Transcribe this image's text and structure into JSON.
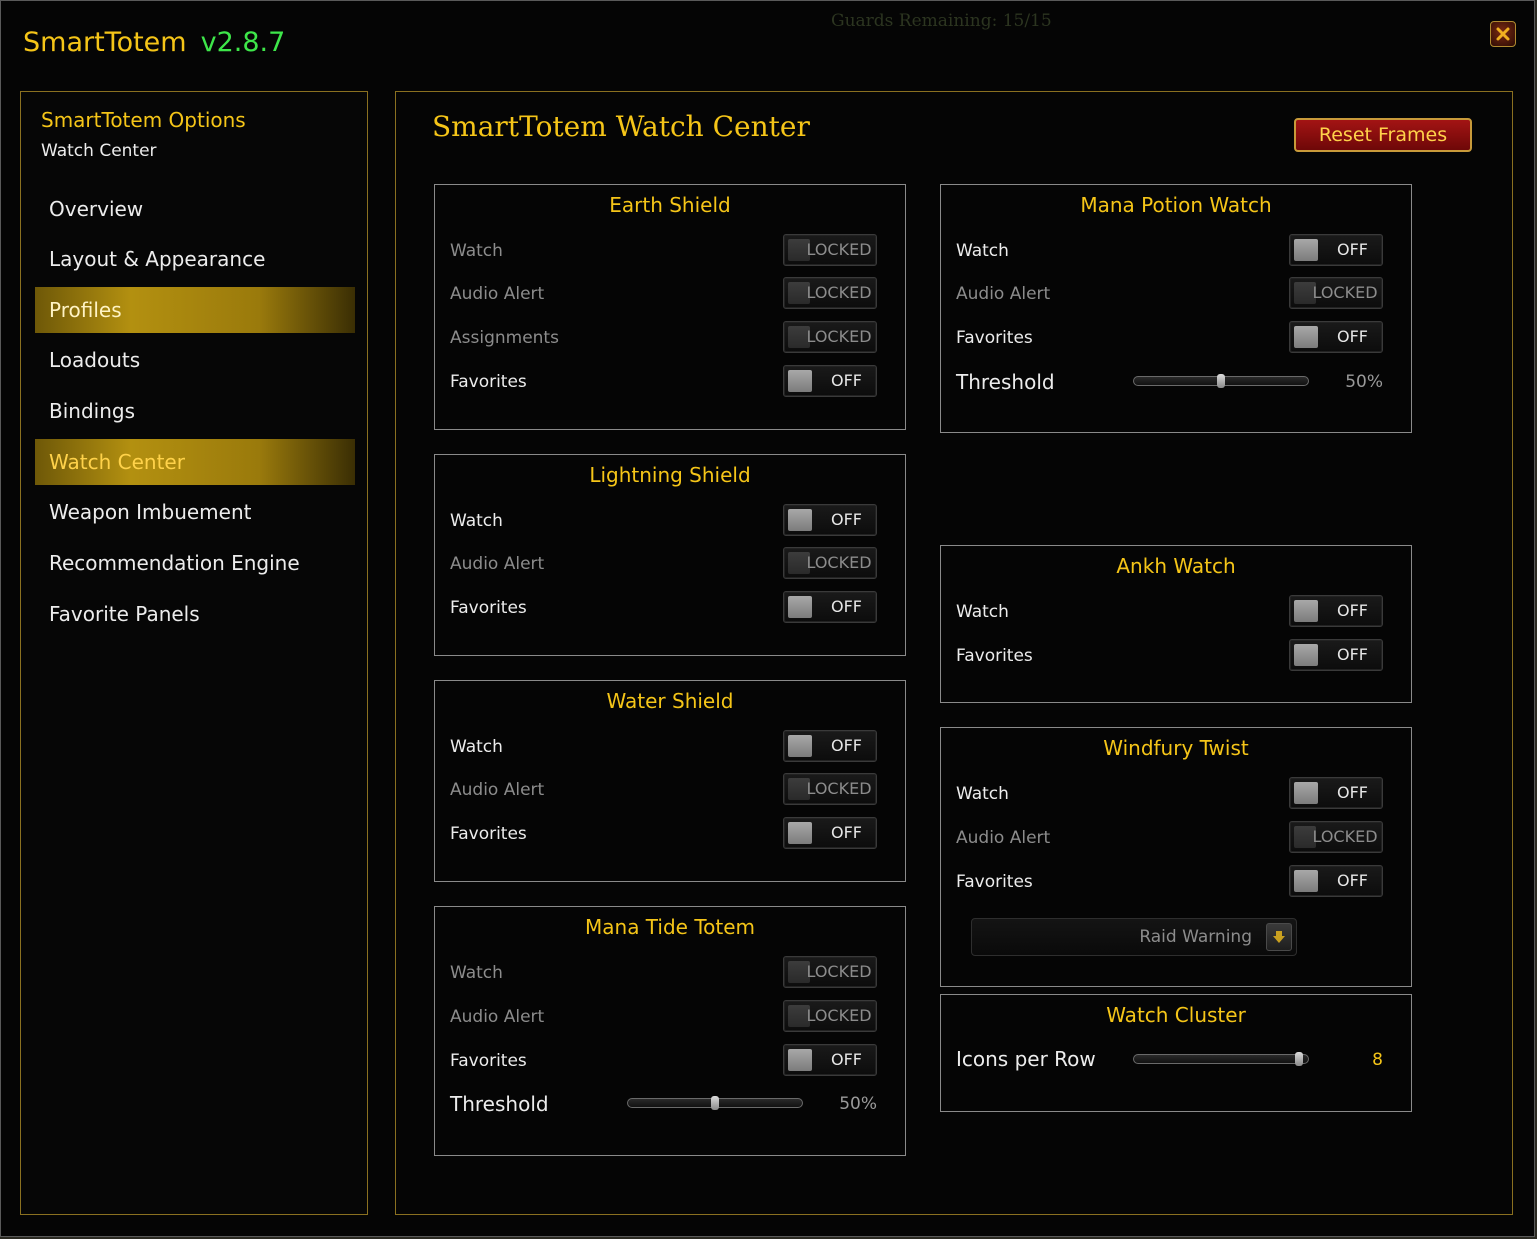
{
  "window": {
    "app_name": "SmartTotem",
    "version": "v2.8.7",
    "background_text": "Guards Remaining: 15/15"
  },
  "sidebar": {
    "title": "SmartTotem Options",
    "subtitle": "Watch Center",
    "items": [
      {
        "label": "Overview",
        "active": false
      },
      {
        "label": "Layout & Appearance",
        "active": false
      },
      {
        "label": "Profiles",
        "active": true
      },
      {
        "label": "Loadouts",
        "active": false
      },
      {
        "label": "Bindings",
        "active": false
      },
      {
        "label": "Watch Center",
        "active": true
      },
      {
        "label": "Weapon Imbuement",
        "active": false
      },
      {
        "label": "Recommendation Engine",
        "active": false
      },
      {
        "label": "Favorite Panels",
        "active": false
      }
    ]
  },
  "main": {
    "title": "SmartTotem  Watch Center",
    "reset_label": "Reset Frames"
  },
  "cards": {
    "earth_shield": {
      "title": "Earth Shield",
      "rows": [
        {
          "label": "Watch",
          "state": "LOCKED"
        },
        {
          "label": "Audio Alert",
          "state": "LOCKED"
        },
        {
          "label": "Assignments",
          "state": "LOCKED"
        },
        {
          "label": "Favorites",
          "state": "OFF"
        }
      ]
    },
    "lightning_shield": {
      "title": "Lightning Shield",
      "rows": [
        {
          "label": "Watch",
          "state": "OFF"
        },
        {
          "label": "Audio Alert",
          "state": "LOCKED"
        },
        {
          "label": "Favorites",
          "state": "OFF"
        }
      ]
    },
    "water_shield": {
      "title": "Water Shield",
      "rows": [
        {
          "label": "Watch",
          "state": "OFF"
        },
        {
          "label": "Audio Alert",
          "state": "LOCKED"
        },
        {
          "label": "Favorites",
          "state": "OFF"
        }
      ]
    },
    "mana_tide": {
      "title": "Mana Tide Totem",
      "rows": [
        {
          "label": "Watch",
          "state": "LOCKED"
        },
        {
          "label": "Audio Alert",
          "state": "LOCKED"
        },
        {
          "label": "Favorites",
          "state": "OFF"
        }
      ],
      "threshold_label": "Threshold",
      "threshold_value": "50%",
      "threshold_fraction": 0.5
    },
    "mana_potion": {
      "title": "Mana Potion Watch",
      "rows": [
        {
          "label": "Watch",
          "state": "OFF"
        },
        {
          "label": "Audio Alert",
          "state": "LOCKED"
        },
        {
          "label": "Favorites",
          "state": "OFF"
        }
      ],
      "threshold_label": "Threshold",
      "threshold_value": "50%",
      "threshold_fraction": 0.5
    },
    "ankh": {
      "title": "Ankh Watch",
      "rows": [
        {
          "label": "Watch",
          "state": "OFF"
        },
        {
          "label": "Favorites",
          "state": "OFF"
        }
      ]
    },
    "windfury": {
      "title": "Windfury Twist",
      "rows": [
        {
          "label": "Watch",
          "state": "OFF"
        },
        {
          "label": "Audio Alert",
          "state": "LOCKED"
        },
        {
          "label": "Favorites",
          "state": "OFF"
        }
      ],
      "dropdown_value": "Raid Warning"
    },
    "watch_cluster": {
      "title": "Watch Cluster",
      "icons_label": "Icons per Row",
      "icons_value": "8",
      "icons_fraction": 0.95
    }
  },
  "colors": {
    "gold": "#f5c518",
    "version_green": "#3ee64a",
    "reset_red": "#a31414"
  }
}
